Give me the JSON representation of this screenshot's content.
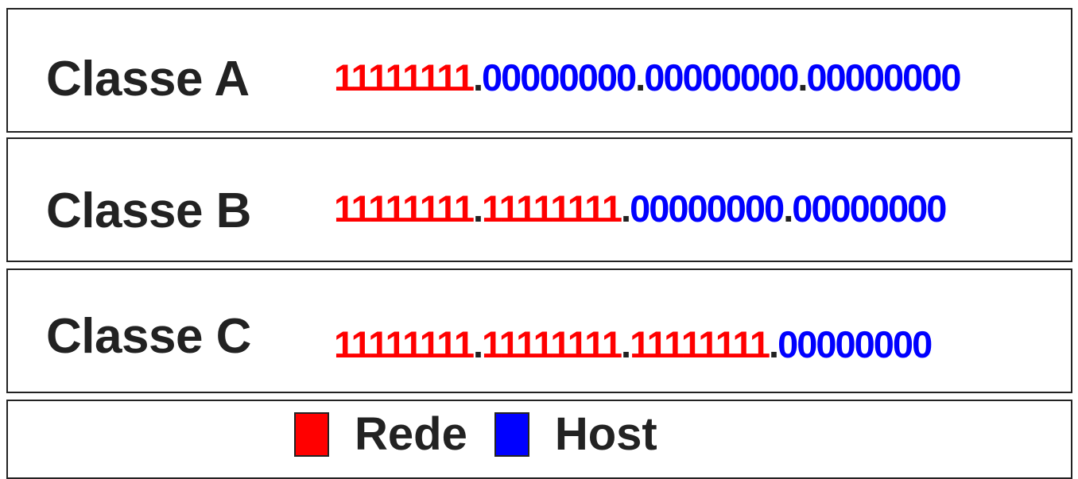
{
  "colors": {
    "rede": "#ff0000",
    "host": "#0000ff"
  },
  "rows": [
    {
      "label": "Classe A",
      "octets": [
        {
          "value": "11111111",
          "type": "rede"
        },
        {
          "value": "00000000",
          "type": "host"
        },
        {
          "value": "00000000",
          "type": "host"
        },
        {
          "value": "00000000",
          "type": "host"
        }
      ]
    },
    {
      "label": "Classe B",
      "octets": [
        {
          "value": "11111111",
          "type": "rede"
        },
        {
          "value": "11111111",
          "type": "rede"
        },
        {
          "value": "00000000",
          "type": "host"
        },
        {
          "value": "00000000",
          "type": "host"
        }
      ]
    },
    {
      "label": "Classe C",
      "octets": [
        {
          "value": "11111111",
          "type": "rede"
        },
        {
          "value": "11111111",
          "type": "rede"
        },
        {
          "value": "11111111",
          "type": "rede"
        },
        {
          "value": "00000000",
          "type": "host"
        }
      ]
    }
  ],
  "separator": ".",
  "legend": {
    "rede_label": "Rede",
    "host_label": "Host"
  }
}
